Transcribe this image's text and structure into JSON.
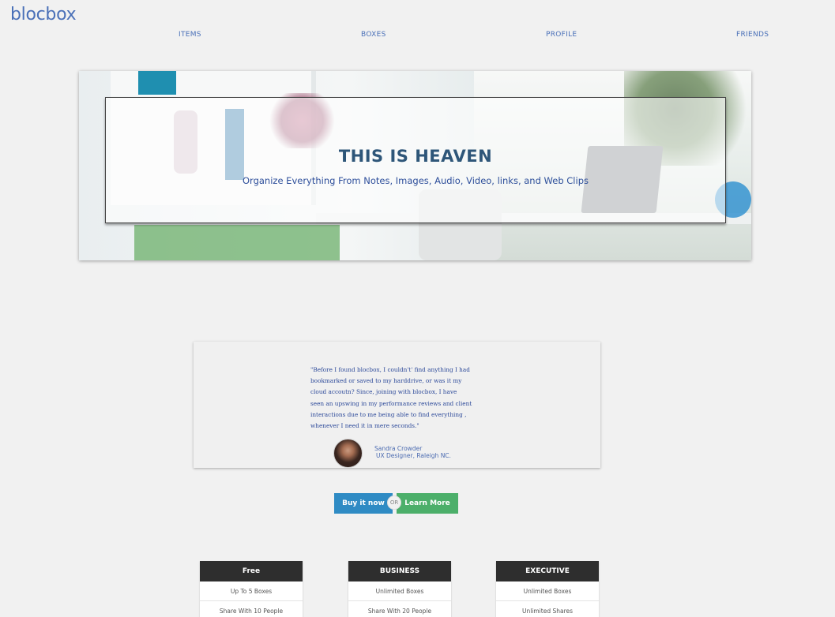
{
  "brand": {
    "logo": "blocbox"
  },
  "nav": {
    "items": [
      "ITEMS",
      "BOXES",
      "PROFILE",
      "FRIENDS"
    ]
  },
  "hero": {
    "title": "THIS IS HEAVEN",
    "subtitle": "Organize Everything From Notes, Images, Audio, Video, links, and Web Clips"
  },
  "testimonial": {
    "lines": [
      "\"Before I found blocbox, I couldn't' find anything I had",
      "bookmarked or saved to my harddrive, or was it my",
      "cloud accoutn? Since, joining with blocbox, I have",
      "seen an upswing in my performance reviews and client",
      "interactions due to me being able to find everything ,",
      "whenever I need it in mere seconds.\""
    ],
    "name": "Sandra Crowder",
    "role": "UX Designer, Raleigh NC."
  },
  "cta": {
    "buy": "Buy it now",
    "or": "OR",
    "learn": "Learn More"
  },
  "plans": [
    {
      "name": "Free",
      "features": [
        "Up To 5 Boxes",
        "Share With 10 People"
      ]
    },
    {
      "name": "BUSINESS",
      "features": [
        "Unlimited Boxes",
        "Share With 20 People"
      ]
    },
    {
      "name": "EXECUTIVE",
      "features": [
        "Unlimited Boxes",
        "Unlimited Shares"
      ]
    }
  ],
  "colors": {
    "accent": "#4a70b8",
    "buy": "#2f8bc4",
    "learn": "#4caf6a",
    "plan_header": "#2e2e2e"
  }
}
